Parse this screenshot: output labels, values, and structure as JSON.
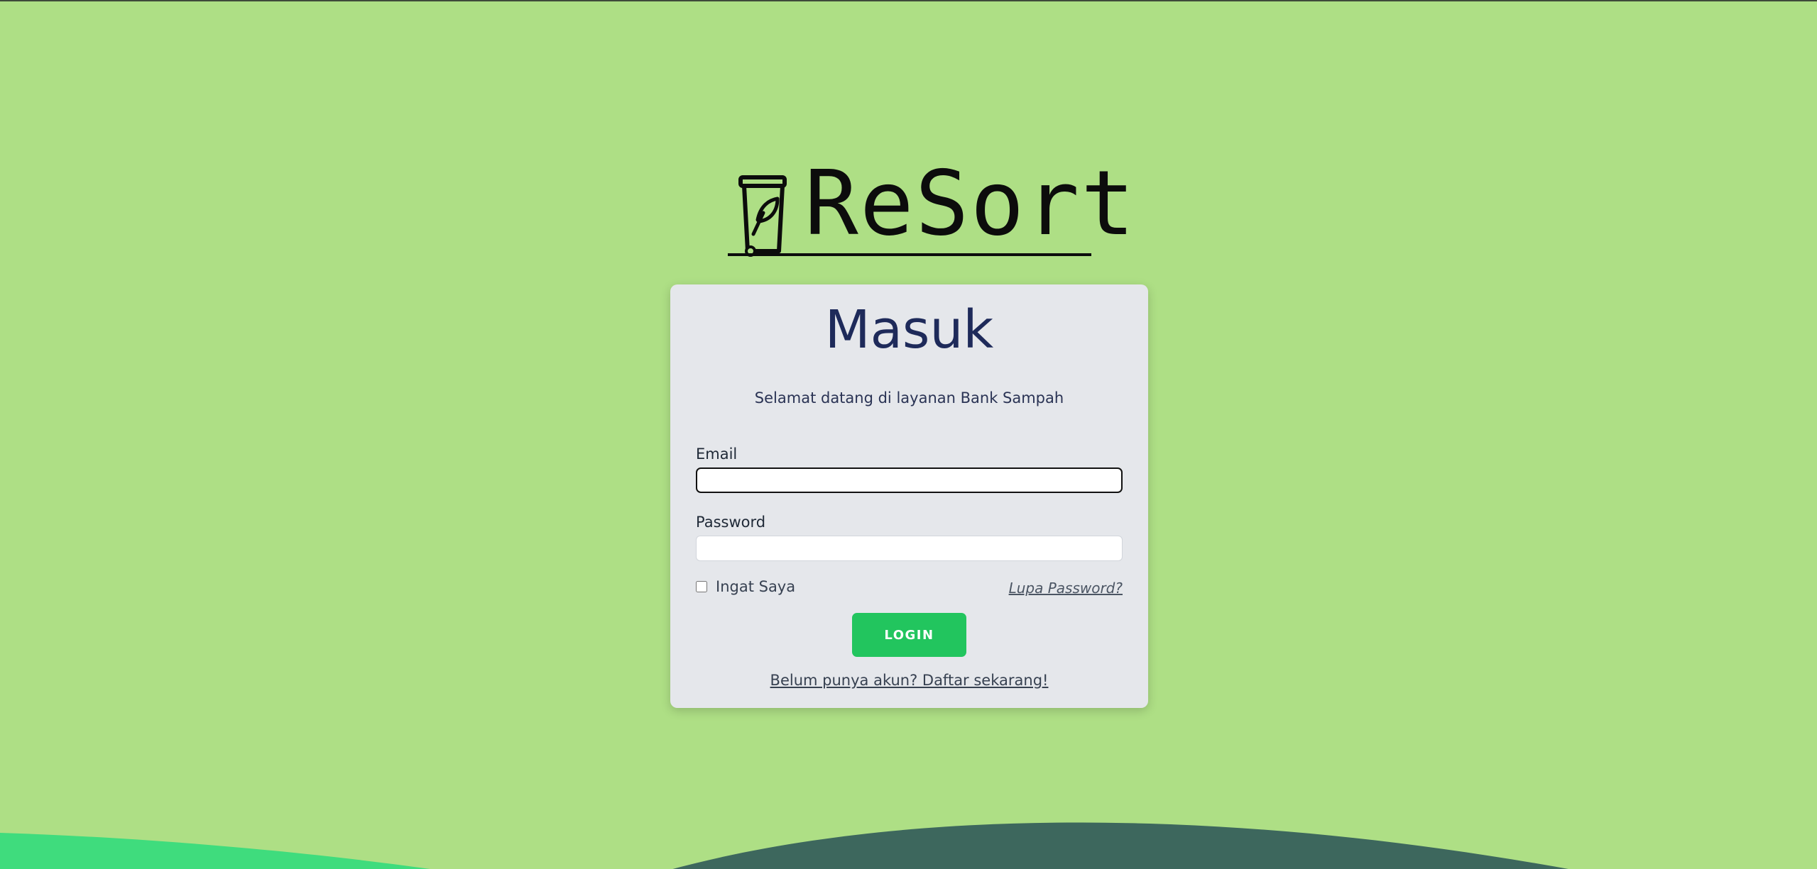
{
  "brand": {
    "name": "ReSort"
  },
  "login_card": {
    "title": "Masuk",
    "subtitle": "Selamat datang di layanan Bank Sampah",
    "email_label": "Email",
    "email_value": "",
    "password_label": "Password",
    "password_value": "",
    "remember_label": "Ingat Saya",
    "remember_checked": false,
    "forgot_link": "Lupa Password?",
    "login_button": "LOGIN",
    "register_link": "Belum punya akun? Daftar sekarang!"
  },
  "colors": {
    "background": "#aedf85",
    "card": "#e5e7eb",
    "title": "#1e2a5a",
    "button": "#22c55e",
    "wave_dark": "#3d675d",
    "wave_light": "#3fdc7d"
  },
  "icons": {
    "logo_mark": "trash-bin-leaf-icon"
  }
}
